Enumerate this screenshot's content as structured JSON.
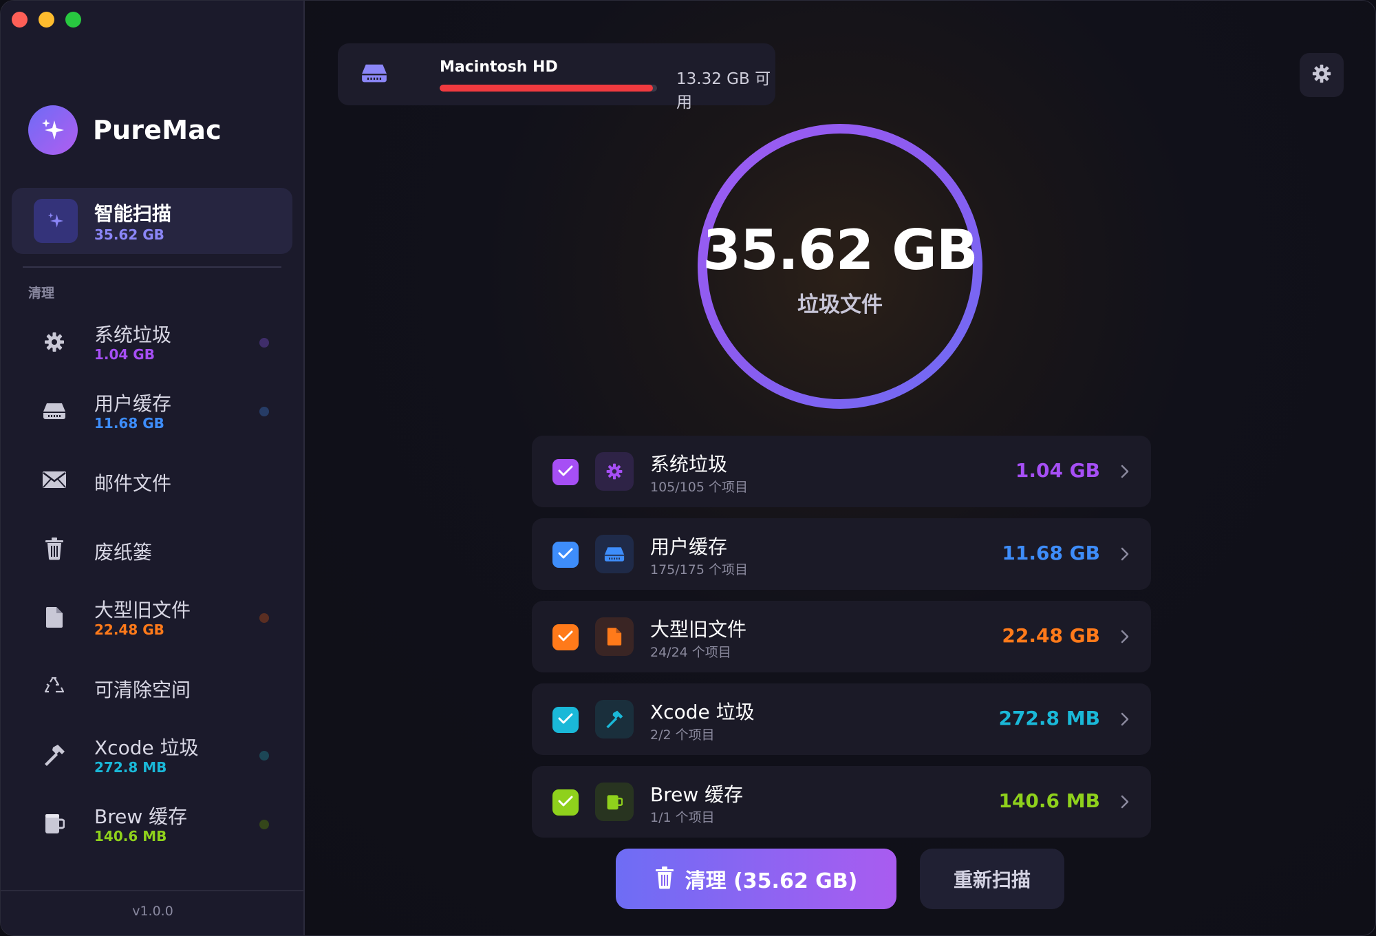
{
  "app": {
    "name": "PureMac",
    "version": "v1.0.0"
  },
  "sidebar": {
    "smart_scan": {
      "label": "智能扫描",
      "size": "35.62 GB"
    },
    "section_label": "清理",
    "items": [
      {
        "label": "系统垃圾",
        "size": "1.04 GB",
        "color": "#a64ff5",
        "icon": "gear-icon"
      },
      {
        "label": "用户缓存",
        "size": "11.68 GB",
        "color": "#3e8dfa",
        "icon": "drive-icon"
      },
      {
        "label": "邮件文件",
        "size": "",
        "color": "",
        "icon": "envelope-icon"
      },
      {
        "label": "废纸篓",
        "size": "",
        "color": "",
        "icon": "trash-icon"
      },
      {
        "label": "大型旧文件",
        "size": "22.48 GB",
        "color": "#ff7a1a",
        "icon": "document-icon"
      },
      {
        "label": "可清除空间",
        "size": "",
        "color": "",
        "icon": "recycle-icon"
      },
      {
        "label": "Xcode 垃圾",
        "size": "272.8 MB",
        "color": "#1ab8d8",
        "icon": "hammer-icon"
      },
      {
        "label": "Brew 缓存",
        "size": "140.6 MB",
        "color": "#8fd11c",
        "icon": "mug-icon"
      }
    ]
  },
  "disk": {
    "name": "Macintosh HD",
    "free": "13.32 GB 可用",
    "used_fraction": 0.98
  },
  "summary": {
    "total": "35.62 GB",
    "label": "垃圾文件"
  },
  "categories": [
    {
      "name": "系统垃圾",
      "count": "105/105 个项目",
      "size": "1.04 GB",
      "color": "#a64ff5",
      "tile_bg": "#2e2346",
      "icon": "gear-icon",
      "checked": true
    },
    {
      "name": "用户缓存",
      "count": "175/175 个项目",
      "size": "11.68 GB",
      "color": "#3e8dfa",
      "tile_bg": "#1f2a48",
      "icon": "drive-icon",
      "checked": true
    },
    {
      "name": "大型旧文件",
      "count": "24/24 个项目",
      "size": "22.48 GB",
      "color": "#ff7a1a",
      "tile_bg": "#3a2524",
      "icon": "document-icon",
      "checked": true
    },
    {
      "name": "Xcode 垃圾",
      "count": "2/2 个项目",
      "size": "272.8 MB",
      "color": "#1ab8d8",
      "tile_bg": "#1a2f3c",
      "icon": "hammer-icon",
      "checked": true
    },
    {
      "name": "Brew 缓存",
      "count": "1/1 个项目",
      "size": "140.6 MB",
      "color": "#8fd11c",
      "tile_bg": "#283420",
      "icon": "mug-icon",
      "checked": true
    }
  ],
  "actions": {
    "clean": "清理 (35.62 GB)",
    "rescan": "重新扫描"
  }
}
